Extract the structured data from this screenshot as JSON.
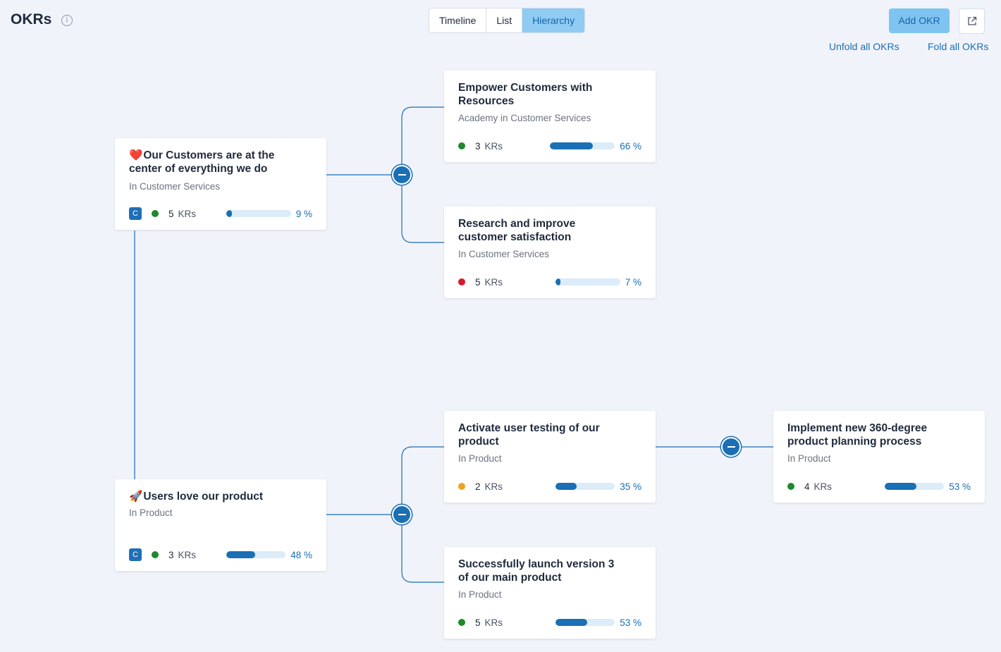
{
  "header": {
    "title": "OKRs",
    "info_icon": "info-icon",
    "views": [
      "Timeline",
      "List",
      "Hierarchy"
    ],
    "active_view": "Hierarchy",
    "add_label": "Add OKR",
    "external_icon": "external-link-icon",
    "unfold_label": "Unfold all OKRs",
    "fold_label": "Fold all OKRs"
  },
  "colors": {
    "accent": "#1a6fb5",
    "on_track": "#1e8a2b",
    "off_track": "#d7192c",
    "at_risk": "#f0a21f",
    "progress_track": "#dcecf8"
  },
  "okrs": [
    {
      "emoji": "❤️",
      "title": "Our Customers are at the center of everything we do",
      "sub": "In Customer Services",
      "badge": "C",
      "status": "on_track",
      "kr_count": "5",
      "kr_label": "KRs",
      "progress": 0.09,
      "pct": "9 %"
    },
    {
      "emoji": "",
      "title": "Empower Customers with Resources",
      "sub": "Academy in Customer Services",
      "badge": "",
      "status": "on_track",
      "kr_count": "3",
      "kr_label": "KRs",
      "progress": 0.66,
      "pct": "66 %"
    },
    {
      "emoji": "",
      "title": "Research and improve customer satisfaction",
      "sub": "In Customer Services",
      "badge": "",
      "status": "off_track",
      "kr_count": "5",
      "kr_label": "KRs",
      "progress": 0.07,
      "pct": "7 %"
    },
    {
      "emoji": "🚀",
      "title": "Users love our product",
      "sub": "In Product",
      "badge": "C",
      "status": "on_track",
      "kr_count": "3",
      "kr_label": "KRs",
      "progress": 0.48,
      "pct": "48 %"
    },
    {
      "emoji": "",
      "title": "Activate user testing of our product",
      "sub": "In Product",
      "badge": "",
      "status": "at_risk",
      "kr_count": "2",
      "kr_label": "KRs",
      "progress": 0.35,
      "pct": "35 %"
    },
    {
      "emoji": "",
      "title": "Successfully launch version 3 of our main product",
      "sub": "In Product",
      "badge": "",
      "status": "on_track",
      "kr_count": "5",
      "kr_label": "KRs",
      "progress": 0.53,
      "pct": "53 %"
    },
    {
      "emoji": "",
      "title": "Implement new 360-degree product planning process",
      "sub": "In Product",
      "badge": "",
      "status": "on_track",
      "kr_count": "4",
      "kr_label": "KRs",
      "progress": 0.53,
      "pct": "53 %"
    }
  ]
}
